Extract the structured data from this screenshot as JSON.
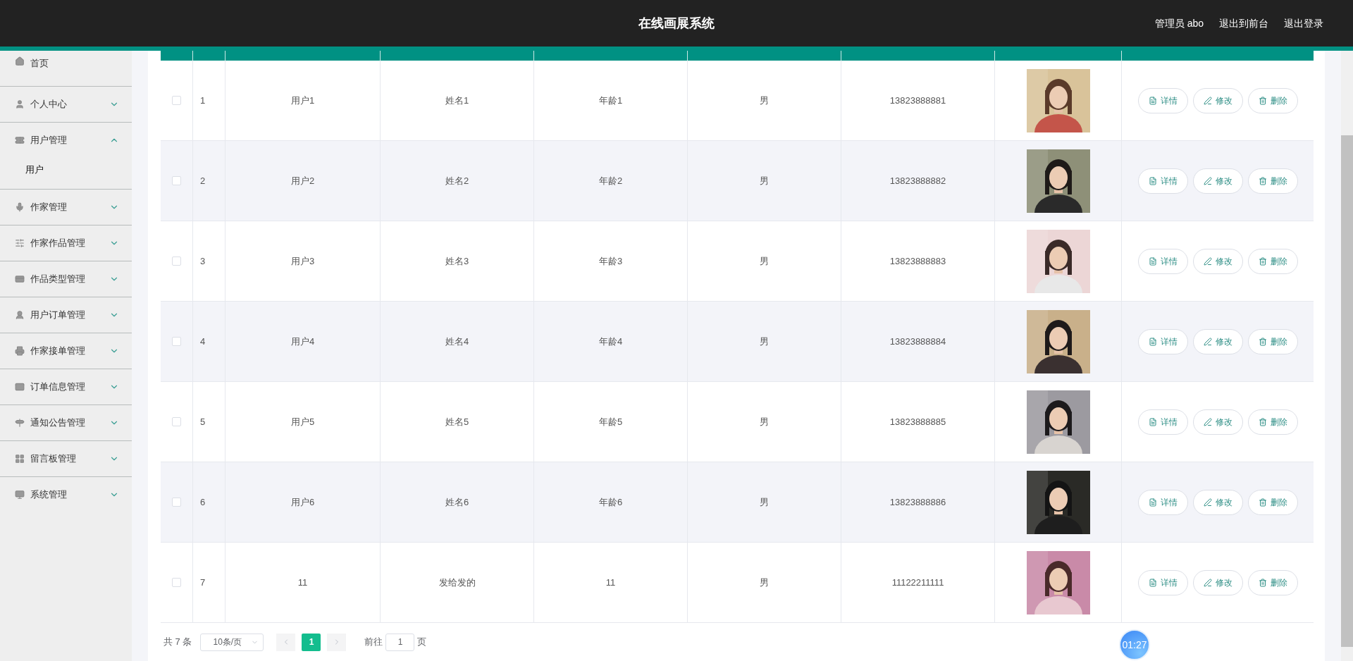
{
  "header": {
    "title": "在线画展系统",
    "links": [
      "管理员 abo",
      "退出到前台",
      "退出登录"
    ]
  },
  "sidebar": {
    "items": [
      {
        "label": "首页"
      },
      {
        "label": "个人中心",
        "expanded": false
      },
      {
        "label": "用户管理",
        "expanded": true,
        "children": [
          {
            "label": "用户"
          }
        ]
      },
      {
        "label": "作家管理",
        "expanded": false
      },
      {
        "label": "作家作品管理",
        "expanded": false
      },
      {
        "label": "作品类型管理",
        "expanded": false
      },
      {
        "label": "用户订单管理",
        "expanded": false
      },
      {
        "label": "作家接单管理",
        "expanded": false
      },
      {
        "label": "订单信息管理",
        "expanded": false
      },
      {
        "label": "通知公告管理",
        "expanded": false
      },
      {
        "label": "留言板管理",
        "expanded": false
      },
      {
        "label": "系统管理",
        "expanded": false
      }
    ]
  },
  "table": {
    "rows": [
      {
        "checked": false,
        "index": "1",
        "username": "用户1",
        "name": "姓名1",
        "age": "年龄1",
        "gender": "男",
        "phone": "13823888881",
        "actions": [
          "详情",
          "修改",
          "删除"
        ]
      },
      {
        "checked": false,
        "index": "2",
        "username": "用户2",
        "name": "姓名2",
        "age": "年龄2",
        "gender": "男",
        "phone": "13823888882",
        "actions": [
          "详情",
          "修改",
          "删除"
        ]
      },
      {
        "checked": false,
        "index": "3",
        "username": "用户3",
        "name": "姓名3",
        "age": "年龄3",
        "gender": "男",
        "phone": "13823888883",
        "actions": [
          "详情",
          "修改",
          "删除"
        ]
      },
      {
        "checked": false,
        "index": "4",
        "username": "用户4",
        "name": "姓名4",
        "age": "年龄4",
        "gender": "男",
        "phone": "13823888884",
        "actions": [
          "详情",
          "修改",
          "删除"
        ]
      },
      {
        "checked": false,
        "index": "5",
        "username": "用户5",
        "name": "姓名5",
        "age": "年龄5",
        "gender": "男",
        "phone": "13823888885",
        "actions": [
          "详情",
          "修改",
          "删除"
        ]
      },
      {
        "checked": false,
        "index": "6",
        "username": "用户6",
        "name": "姓名6",
        "age": "年龄6",
        "gender": "男",
        "phone": "13823888886",
        "actions": [
          "详情",
          "修改",
          "删除"
        ]
      },
      {
        "checked": false,
        "index": "7",
        "username": "11",
        "name": "发给发的",
        "age": "11",
        "gender": "男",
        "phone": "11122211111",
        "actions": [
          "详情",
          "修改",
          "删除"
        ]
      }
    ]
  },
  "pagination": {
    "total": "共 7 条",
    "page_size": "10条/页",
    "pages": [
      {
        "label": "1",
        "selected": true
      }
    ],
    "goto_label": "前往",
    "goto_value": "1",
    "page_unit": "页"
  },
  "timer": "01:27"
}
